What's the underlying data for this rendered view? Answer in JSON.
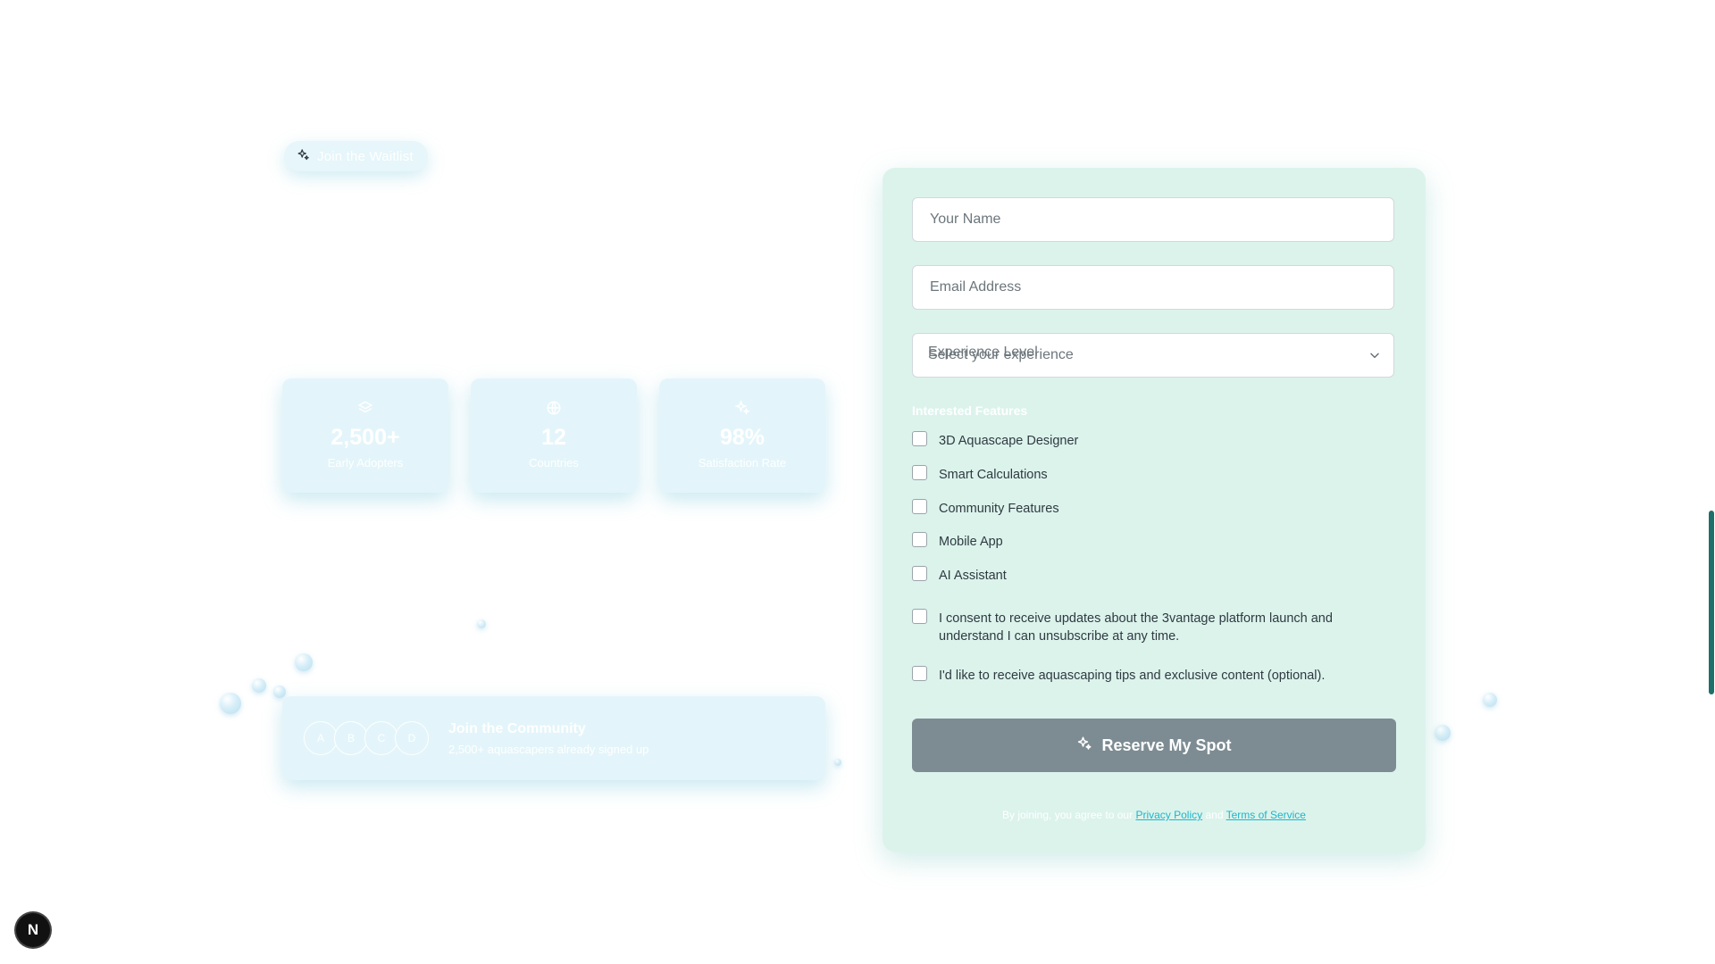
{
  "waitlist": {
    "label": "Join the Waitlist",
    "icon": "sparkles-icon"
  },
  "stats": [
    {
      "icon": "layers-icon",
      "value": "2,500+",
      "label": "Early Adopters"
    },
    {
      "icon": "globe-icon",
      "value": "12",
      "label": "Countries"
    },
    {
      "icon": "sparkles-icon",
      "value": "98%",
      "label": "Satisfaction Rate"
    }
  ],
  "community": {
    "avatars": [
      "A",
      "B",
      "C",
      "D"
    ],
    "title": "Join the Community",
    "subtitle": "2,500+ aquascapers already signed up"
  },
  "form": {
    "name_placeholder": "Your Name",
    "email_placeholder": "Email Address",
    "experience_label": "Experience Level",
    "experience_value": "Select your experience",
    "features_heading": "Interested Features",
    "features": [
      "3D Aquascape Designer",
      "Smart Calculations",
      "Community Features",
      "Mobile App",
      "AI Assistant"
    ],
    "consent_text": "I consent to receive updates about the 3vantage platform launch and understand I can unsubscribe at any time.",
    "tips_text": "I'd like to receive aquascaping tips and exclusive content (optional).",
    "submit_label": "Reserve My Spot",
    "legal_prefix": "By joining, you agree to our",
    "privacy_label": "Privacy Policy",
    "legal_and": "and",
    "terms_label": "Terms of Service"
  },
  "badge": {
    "label": "N"
  },
  "colors": {
    "accent_teal": "#1fb6c9",
    "form_bg": "#dcf3ec",
    "button_bg": "#7d8c92",
    "scroll_thumb": "#1f6f6b"
  }
}
